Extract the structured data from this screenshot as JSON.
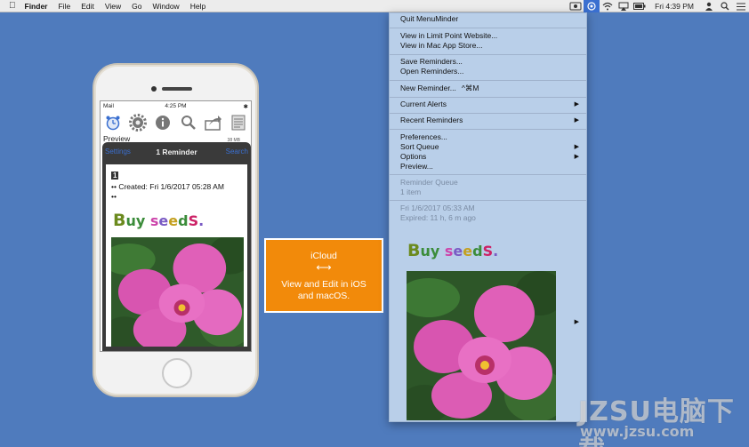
{
  "menubar": {
    "apple_icon": "apple-logo",
    "app_name": "Finder",
    "menus": [
      "File",
      "Edit",
      "View",
      "Go",
      "Window",
      "Help"
    ],
    "status_icons": [
      "menuminder-status-icon",
      "reminder-active-icon",
      "wifi-icon",
      "airplay-icon",
      "battery-icon"
    ],
    "clock": "Fri 4:39 PM",
    "right_icons": [
      "user-icon",
      "spotlight-icon",
      "notification-center-icon"
    ]
  },
  "dropdown": {
    "items": [
      {
        "label": "Quit MenuMinder"
      },
      {
        "label": "View in Limit Point Website..."
      },
      {
        "label": "View in Mac App Store..."
      },
      {
        "label": "Save Reminders..."
      },
      {
        "label": "Open Reminders..."
      },
      {
        "label": "New Reminder...",
        "shortcut": "^⌘M"
      },
      {
        "label": "Current Alerts",
        "submenu": "▶"
      },
      {
        "label": "Recent Reminders",
        "submenu": "▶"
      },
      {
        "label": "Preferences..."
      },
      {
        "label": "Sort Queue",
        "submenu": "▶"
      },
      {
        "label": "Options",
        "submenu": "▶"
      },
      {
        "label": "Preview..."
      },
      {
        "label": "Reminder Queue"
      },
      {
        "label": "1 item"
      },
      {
        "label": "Fri 1/6/2017 05:33 AM"
      },
      {
        "label": "Expired: 11 h, 6 m ago"
      }
    ],
    "preview_submenu_arrow": "▶",
    "buy_seeds": [
      "B",
      "u",
      "y",
      " ",
      "s",
      "e",
      "e",
      "d",
      "S",
      "."
    ]
  },
  "phone": {
    "status": {
      "left": "Mail",
      "time": "4:25 PM",
      "right": "✱"
    },
    "toolbar_icons": [
      "alarm-clock-icon",
      "gear-icon",
      "info-icon",
      "search-icon",
      "share-icon",
      "notes-icon"
    ],
    "preview_label": "Preview",
    "size_label": "38 MB",
    "nav": {
      "left": "Settings",
      "title": "1 Reminder",
      "right": "Search"
    },
    "card": {
      "number": "1",
      "created": "•• Created: Fri 1/6/2017 05:28 AM",
      "bullet": "••"
    },
    "buy_seeds": [
      "B",
      "u",
      "y",
      " ",
      "s",
      "e",
      "e",
      "d",
      "S",
      "."
    ]
  },
  "icloud": {
    "title": "iCloud",
    "arrow": "⟷",
    "line1": "View and Edit in iOS",
    "line2": "and macOS."
  },
  "watermark": {
    "big": "JZSU电脑下载",
    "small": "www.jzsu.com"
  },
  "colors": {
    "desktop": "#4f7bbd",
    "menu_bg": "#b9cfe9",
    "callout": "#f28a0a",
    "accent": "#3a6fd0"
  }
}
